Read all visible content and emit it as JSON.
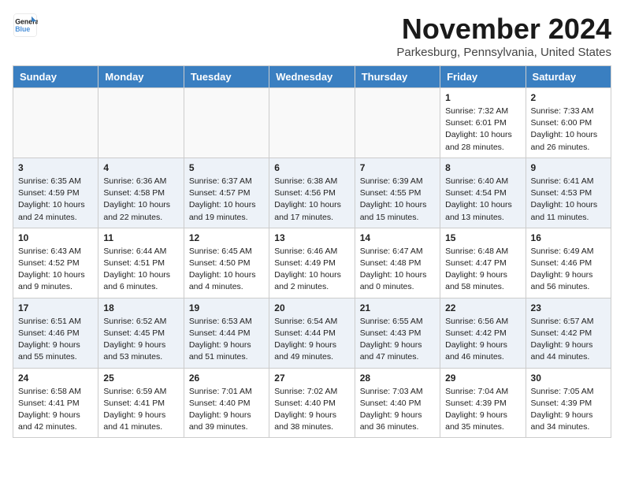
{
  "header": {
    "logo_line1": "General",
    "logo_line2": "Blue",
    "month_title": "November 2024",
    "location": "Parkesburg, Pennsylvania, United States"
  },
  "weekdays": [
    "Sunday",
    "Monday",
    "Tuesday",
    "Wednesday",
    "Thursday",
    "Friday",
    "Saturday"
  ],
  "weeks": [
    [
      {
        "day": "",
        "info": ""
      },
      {
        "day": "",
        "info": ""
      },
      {
        "day": "",
        "info": ""
      },
      {
        "day": "",
        "info": ""
      },
      {
        "day": "",
        "info": ""
      },
      {
        "day": "1",
        "info": "Sunrise: 7:32 AM\nSunset: 6:01 PM\nDaylight: 10 hours and 28 minutes."
      },
      {
        "day": "2",
        "info": "Sunrise: 7:33 AM\nSunset: 6:00 PM\nDaylight: 10 hours and 26 minutes."
      }
    ],
    [
      {
        "day": "3",
        "info": "Sunrise: 6:35 AM\nSunset: 4:59 PM\nDaylight: 10 hours and 24 minutes."
      },
      {
        "day": "4",
        "info": "Sunrise: 6:36 AM\nSunset: 4:58 PM\nDaylight: 10 hours and 22 minutes."
      },
      {
        "day": "5",
        "info": "Sunrise: 6:37 AM\nSunset: 4:57 PM\nDaylight: 10 hours and 19 minutes."
      },
      {
        "day": "6",
        "info": "Sunrise: 6:38 AM\nSunset: 4:56 PM\nDaylight: 10 hours and 17 minutes."
      },
      {
        "day": "7",
        "info": "Sunrise: 6:39 AM\nSunset: 4:55 PM\nDaylight: 10 hours and 15 minutes."
      },
      {
        "day": "8",
        "info": "Sunrise: 6:40 AM\nSunset: 4:54 PM\nDaylight: 10 hours and 13 minutes."
      },
      {
        "day": "9",
        "info": "Sunrise: 6:41 AM\nSunset: 4:53 PM\nDaylight: 10 hours and 11 minutes."
      }
    ],
    [
      {
        "day": "10",
        "info": "Sunrise: 6:43 AM\nSunset: 4:52 PM\nDaylight: 10 hours and 9 minutes."
      },
      {
        "day": "11",
        "info": "Sunrise: 6:44 AM\nSunset: 4:51 PM\nDaylight: 10 hours and 6 minutes."
      },
      {
        "day": "12",
        "info": "Sunrise: 6:45 AM\nSunset: 4:50 PM\nDaylight: 10 hours and 4 minutes."
      },
      {
        "day": "13",
        "info": "Sunrise: 6:46 AM\nSunset: 4:49 PM\nDaylight: 10 hours and 2 minutes."
      },
      {
        "day": "14",
        "info": "Sunrise: 6:47 AM\nSunset: 4:48 PM\nDaylight: 10 hours and 0 minutes."
      },
      {
        "day": "15",
        "info": "Sunrise: 6:48 AM\nSunset: 4:47 PM\nDaylight: 9 hours and 58 minutes."
      },
      {
        "day": "16",
        "info": "Sunrise: 6:49 AM\nSunset: 4:46 PM\nDaylight: 9 hours and 56 minutes."
      }
    ],
    [
      {
        "day": "17",
        "info": "Sunrise: 6:51 AM\nSunset: 4:46 PM\nDaylight: 9 hours and 55 minutes."
      },
      {
        "day": "18",
        "info": "Sunrise: 6:52 AM\nSunset: 4:45 PM\nDaylight: 9 hours and 53 minutes."
      },
      {
        "day": "19",
        "info": "Sunrise: 6:53 AM\nSunset: 4:44 PM\nDaylight: 9 hours and 51 minutes."
      },
      {
        "day": "20",
        "info": "Sunrise: 6:54 AM\nSunset: 4:44 PM\nDaylight: 9 hours and 49 minutes."
      },
      {
        "day": "21",
        "info": "Sunrise: 6:55 AM\nSunset: 4:43 PM\nDaylight: 9 hours and 47 minutes."
      },
      {
        "day": "22",
        "info": "Sunrise: 6:56 AM\nSunset: 4:42 PM\nDaylight: 9 hours and 46 minutes."
      },
      {
        "day": "23",
        "info": "Sunrise: 6:57 AM\nSunset: 4:42 PM\nDaylight: 9 hours and 44 minutes."
      }
    ],
    [
      {
        "day": "24",
        "info": "Sunrise: 6:58 AM\nSunset: 4:41 PM\nDaylight: 9 hours and 42 minutes."
      },
      {
        "day": "25",
        "info": "Sunrise: 6:59 AM\nSunset: 4:41 PM\nDaylight: 9 hours and 41 minutes."
      },
      {
        "day": "26",
        "info": "Sunrise: 7:01 AM\nSunset: 4:40 PM\nDaylight: 9 hours and 39 minutes."
      },
      {
        "day": "27",
        "info": "Sunrise: 7:02 AM\nSunset: 4:40 PM\nDaylight: 9 hours and 38 minutes."
      },
      {
        "day": "28",
        "info": "Sunrise: 7:03 AM\nSunset: 4:40 PM\nDaylight: 9 hours and 36 minutes."
      },
      {
        "day": "29",
        "info": "Sunrise: 7:04 AM\nSunset: 4:39 PM\nDaylight: 9 hours and 35 minutes."
      },
      {
        "day": "30",
        "info": "Sunrise: 7:05 AM\nSunset: 4:39 PM\nDaylight: 9 hours and 34 minutes."
      }
    ]
  ]
}
